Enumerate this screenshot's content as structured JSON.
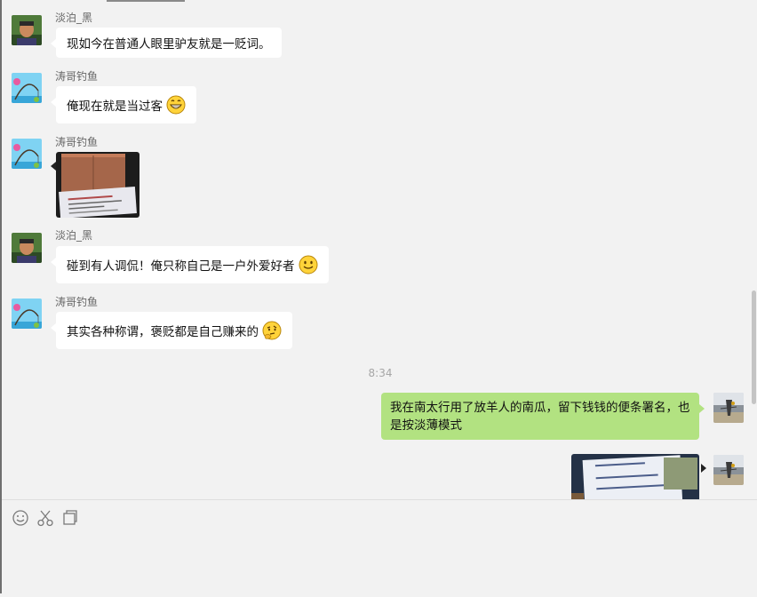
{
  "messages": [
    {
      "sender": "淡泊_黑",
      "text": "现如今在普通人眼里驴友就是一贬词。"
    },
    {
      "sender": "涛哥钓鱼",
      "text": "俺现在就是当过客"
    },
    {
      "sender": "涛哥钓鱼"
    },
    {
      "sender": "淡泊_黑",
      "text": "碰到有人调侃！俺只称自己是一户外爱好者"
    },
    {
      "sender": "涛哥钓鱼",
      "text": "其实各种称谓，褒贬都是自己赚来的"
    }
  ],
  "timestamp": "8:34",
  "my_message": {
    "text": "我在南太行用了放羊人的南瓜，留下钱钱的便条署名，也是按淡薄模式"
  },
  "toolbar": {
    "emoji_icon": "smiley-face-icon",
    "screenshot_icon": "scissors-icon",
    "file_icon": "folder-icon"
  },
  "colors": {
    "my_bubble": "#b2e281",
    "other_bubble": "#ffffff",
    "background": "#f2f2f2"
  }
}
